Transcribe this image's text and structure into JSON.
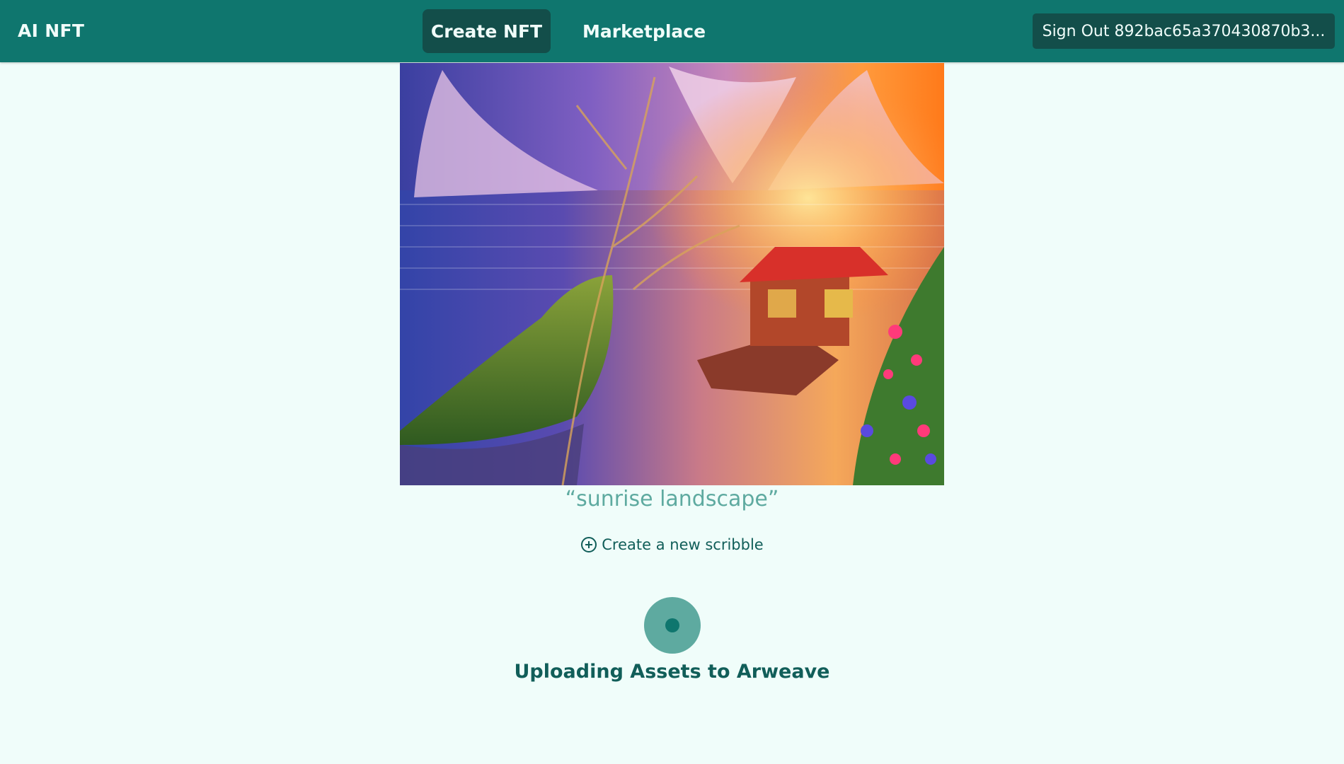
{
  "navbar": {
    "brand": "AI NFT",
    "tabs": [
      {
        "label": "Create NFT",
        "active": true
      },
      {
        "label": "Marketplace",
        "active": false
      }
    ],
    "sign_out_label": "Sign Out 892bac65a370430870b3..."
  },
  "main": {
    "prompt_text": "“sunrise landscape”",
    "new_scribble_label": "Create a new scribble",
    "status_text": "Uploading Assets to Arweave"
  },
  "colors": {
    "nav_bg": "#0f766e",
    "nav_active": "#134e4a",
    "page_bg": "#f0fdfa",
    "accent_text": "#115e59"
  },
  "icons": {
    "new_scribble": "plus-circle-icon",
    "loading": "loading-spinner-icon"
  }
}
